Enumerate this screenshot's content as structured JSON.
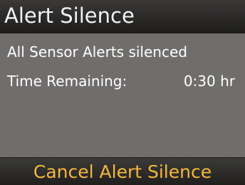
{
  "header": {
    "title": "Alert Silence"
  },
  "main": {
    "status_text": "All Sensor Alerts silenced",
    "time_remaining_label": "Time Remaining:",
    "time_remaining_value": "0:30 hr"
  },
  "footer": {
    "action_label": "Cancel Alert Silence"
  },
  "colors": {
    "header_bg": "#2a2928",
    "body_bg": "#706e6d",
    "text": "#ffffff",
    "action_text": "#f4b73e"
  }
}
